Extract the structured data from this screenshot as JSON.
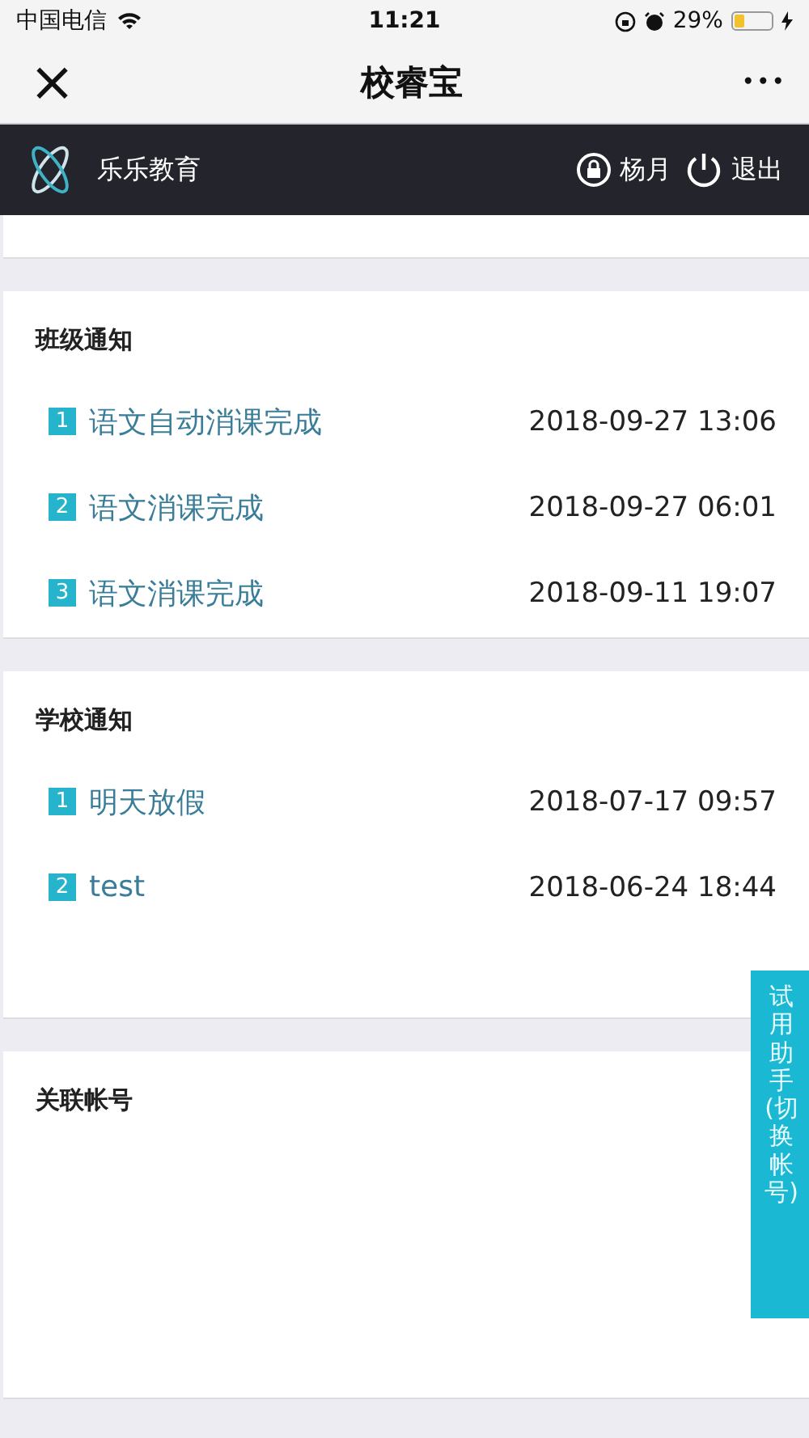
{
  "status_bar": {
    "carrier": "中国电信",
    "time": "11:21",
    "battery": "29%"
  },
  "nav": {
    "close": "×",
    "title": "校睿宝",
    "more": "•••"
  },
  "header": {
    "brand": "乐乐教育",
    "user": "杨月",
    "logout": "退出"
  },
  "sections": [
    {
      "title": "班级通知",
      "items": [
        {
          "index": "1",
          "title": "语文自动消课完成",
          "time": "2018-09-27 13:06"
        },
        {
          "index": "2",
          "title": "语文消课完成",
          "time": "2018-09-27 06:01"
        },
        {
          "index": "3",
          "title": "语文消课完成",
          "time": "2018-09-11 19:07"
        }
      ]
    },
    {
      "title": "学校通知",
      "items": [
        {
          "index": "1",
          "title": "明天放假",
          "time": "2018-07-17 09:57"
        },
        {
          "index": "2",
          "title": "test",
          "time": "2018-06-24 18:44"
        }
      ]
    },
    {
      "title": "关联帐号"
    }
  ],
  "side_tab": "试用助手(切换帐号)"
}
